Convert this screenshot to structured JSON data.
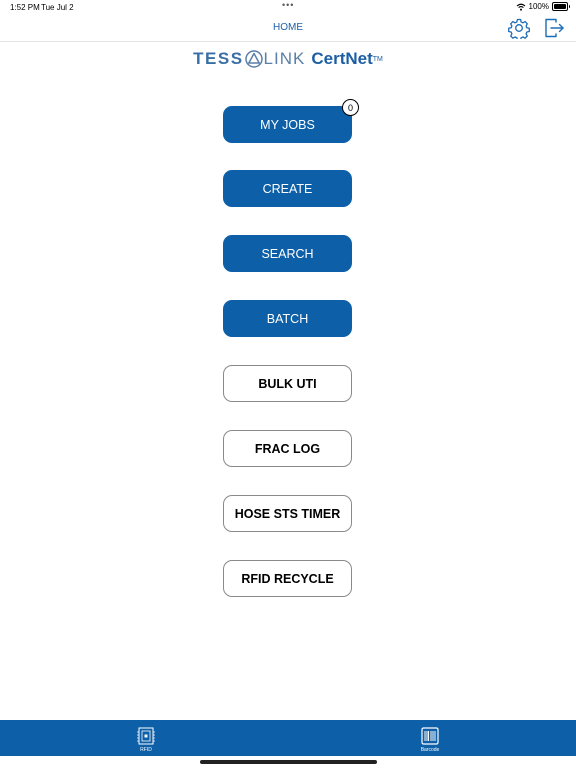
{
  "status_bar": {
    "time": "1:52 PM",
    "date": "Tue Jul 2",
    "dots": "•••",
    "battery_text": "100%",
    "battery_level": 1.0
  },
  "nav": {
    "title": "HOME",
    "settings_icon": "gear-icon",
    "logout_icon": "logout-icon"
  },
  "logo": {
    "brand_left": "TESS",
    "brand_right": "LINK",
    "product": "CertNet",
    "trademark": "TM"
  },
  "menu": {
    "my_jobs": {
      "label": "MY JOBS",
      "badge": "0"
    },
    "create": {
      "label": "CREATE"
    },
    "search": {
      "label": "SEARCH"
    },
    "batch": {
      "label": "BATCH"
    },
    "bulk_uti": {
      "label": "BULK UTI"
    },
    "frac_log": {
      "label": "FRAC LOG"
    },
    "hose_sts_timer": {
      "label": "HOSE STS TIMER"
    },
    "rfid_recycle": {
      "label": "RFID RECYCLE"
    }
  },
  "tab_bar": {
    "rfid": {
      "label": "RFID",
      "icon": "rfid-chip-icon"
    },
    "barcode": {
      "label": "Barcode",
      "icon": "barcode-icon"
    }
  },
  "colors": {
    "primary": "#0d5fa7",
    "nav_title": "#1d5fa6"
  }
}
